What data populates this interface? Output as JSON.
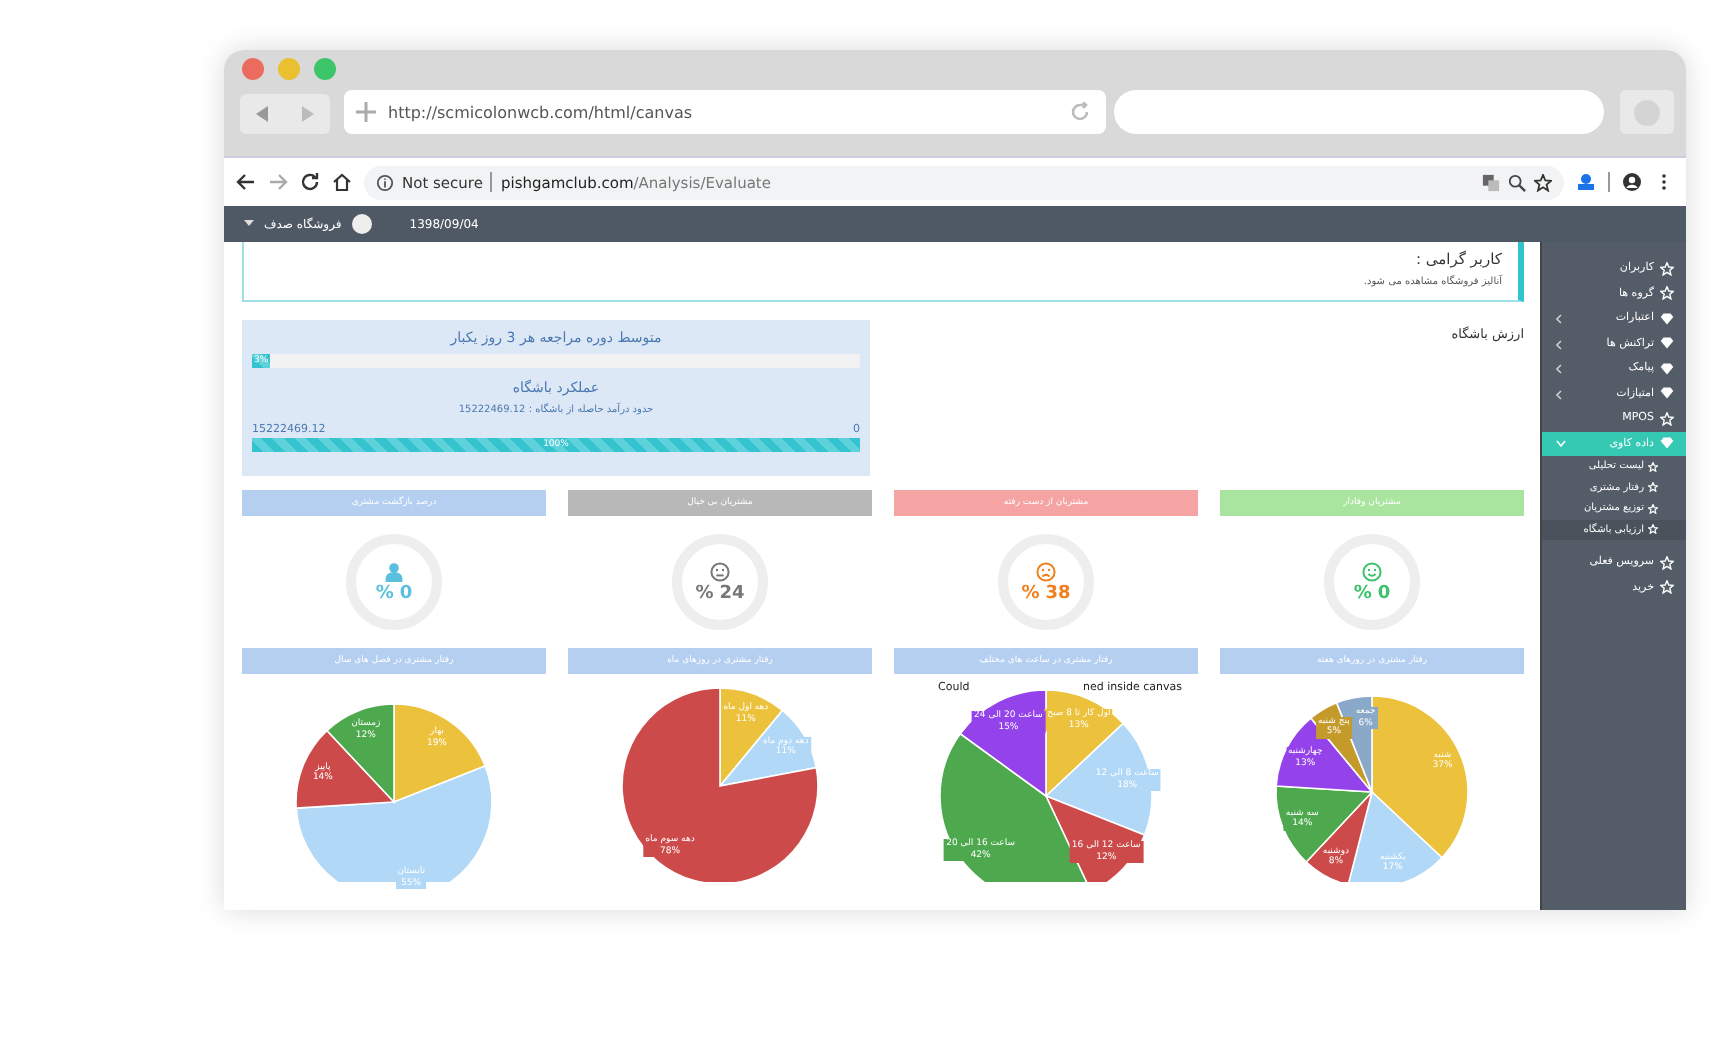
{
  "outer_browser": {
    "url": "http://scmicolonwcb.com/html/canvas"
  },
  "browser": {
    "security": "Not secure",
    "url_domain": "pishgamclub.com",
    "url_path": "/Analysis/Evaluate"
  },
  "header": {
    "store": "فروشگاه صدف",
    "date": "1398/09/04"
  },
  "alert": {
    "title": "کاربر گرامی :",
    "message": "آنالیز فروشگاه مشاهده می شود."
  },
  "section_title": "ارزش باشگاه",
  "club_panel": {
    "visit_title": "متوسط دوره مراجعه هر 3 روز یکبار",
    "visit_bar": {
      "level": 0.03,
      "label": "3%"
    },
    "performance_title": "عملکرد باشگاه",
    "income": "حدود درآمد حاصله از باشگاه : 15222469.12",
    "max": "15222469.12",
    "min": "0",
    "performance_bar": {
      "level": 1,
      "label": "100%"
    }
  },
  "stats": [
    {
      "title": "مشتریان وفادار",
      "color": "#a9e59f",
      "kind": "happy",
      "unit": "%",
      "value": "0"
    },
    {
      "title": "مشتریان از دست رفته",
      "color": "#f5a3a3",
      "kind": "sad",
      "unit": "%",
      "value": "38"
    },
    {
      "title": "مشتریان بی خیال",
      "color": "#b8b8b8",
      "kind": "neutral",
      "unit": "%",
      "value": "24"
    },
    {
      "title": "درصد بازگشت مشتری",
      "color": "#b5cff1",
      "kind": "person",
      "unit": "%",
      "value": "0"
    }
  ],
  "charts": [
    {
      "chart_data": {
        "type": "pie",
        "title": "رفتار مشتری در روزهای هفته",
        "categories": [
          "شنبه",
          "یکشنبه",
          "دوشنبه",
          "سه شنبه",
          "چهارشنبه",
          "پنج شنبه",
          "جمعه"
        ],
        "values": [
          37,
          17,
          8,
          14,
          13,
          5,
          6
        ],
        "colors": [
          "#ecc13c",
          "#b1d8f6",
          "#cc4a4a",
          "#4ea84e",
          "#9442ea",
          "#c49a2a",
          "#8aa8c8"
        ],
        "value_labels": [
          "37%",
          "17%",
          "8%",
          "14%",
          "13%",
          "5%",
          "6%"
        ]
      }
    },
    {
      "chart_data": {
        "type": "pie",
        "title": "رفتار مشتری در ساعت های مختلف",
        "categories": [
          "اول کار تا 8 صبح",
          "ساعت 8 الی 12",
          "ساعت 12 الی 16",
          "ساعت 16 الی 20",
          "ساعت 20 الی 24"
        ],
        "values": [
          13,
          18,
          12,
          42,
          15
        ],
        "colors": [
          "#ecc13c",
          "#b1d8f6",
          "#cc4a4a",
          "#4ea84e",
          "#9442ea"
        ],
        "value_labels": [
          "13%",
          "18%",
          "12%",
          "42%",
          "15%"
        ]
      },
      "note_parts": [
        "ned inside canvas",
        "Could"
      ]
    },
    {
      "chart_data": {
        "type": "pie",
        "title": "رفتار مشتری در روزهای ماه",
        "categories": [
          "دهه اول ماه",
          "دهه دوم ماه",
          "دهه سوم ماه"
        ],
        "values": [
          11,
          11,
          78
        ],
        "colors": [
          "#ecc13c",
          "#b1d8f6",
          "#cc4a4a"
        ],
        "value_labels": [
          "11%",
          "11%",
          "78%"
        ]
      }
    },
    {
      "chart_data": {
        "type": "pie",
        "title": "رفتار مشتری در فصل های سال",
        "categories": [
          "بهار",
          "تابستان",
          "پاییز",
          "زمستان"
        ],
        "values": [
          19,
          55,
          14,
          12
        ],
        "colors": [
          "#ecc13c",
          "#b1d8f6",
          "#cc4a4a",
          "#4ea84e"
        ],
        "value_labels": [
          "19%",
          "55%",
          "14%",
          "12%"
        ]
      }
    }
  ],
  "sidebar": [
    {
      "label": "کاربران",
      "kind": "star",
      "selected": false
    },
    {
      "label": "گروه ها",
      "kind": "star",
      "selected": false
    },
    {
      "label": "اعتبارات",
      "kind": "diamond",
      "expanded": false,
      "selected": false
    },
    {
      "label": "تراکنش ها",
      "kind": "diamond",
      "expanded": false,
      "selected": false
    },
    {
      "label": "پیامک",
      "kind": "diamond",
      "expanded": false,
      "selected": false
    },
    {
      "label": "امتیازات",
      "kind": "diamond",
      "expanded": false,
      "selected": false
    },
    {
      "label": "MPOS",
      "kind": "star",
      "selected": false
    },
    {
      "label": "داده کاوی",
      "kind": "diamond",
      "expanded": true,
      "selected": true,
      "children": [
        {
          "label": "لیست تحلیلی",
          "selected": false
        },
        {
          "label": "رفتار مشتری",
          "selected": false
        },
        {
          "label": "توزیع مشتریان",
          "selected": false
        },
        {
          "label": "ارزیابی باشگاه",
          "selected": true
        }
      ]
    },
    {
      "label": "سرویس فعلی",
      "kind": "star",
      "selected": false
    },
    {
      "label": "خرید",
      "kind": "star",
      "selected": false
    }
  ]
}
